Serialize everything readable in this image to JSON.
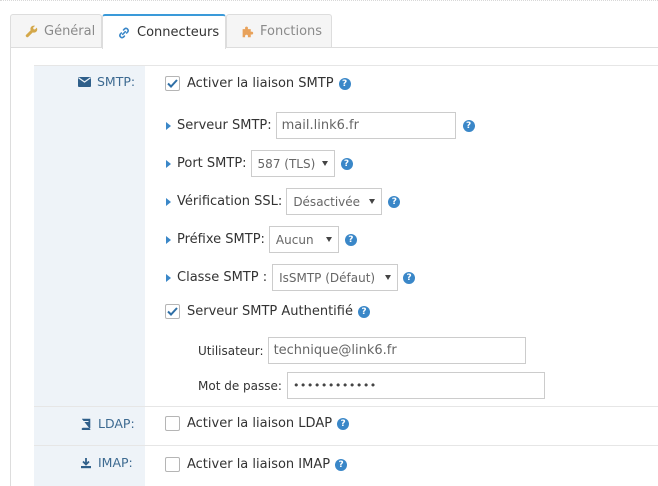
{
  "tabs": [
    {
      "label": "Général",
      "icon": "wrench-icon"
    },
    {
      "label": "Connecteurs",
      "icon": "link-icon"
    },
    {
      "label": "Fonctions",
      "icon": "puzzle-icon"
    }
  ],
  "colors": {
    "accent": "#3a87c8",
    "label_bg": "#eef3f8",
    "tab_active_border": "#3a9ad9"
  },
  "smtp": {
    "section_label": "SMTP:",
    "enable_label": "Activer la liaison SMTP",
    "enabled": true,
    "server_label": "Serveur SMTP:",
    "server_value": "mail.link6.fr",
    "port_label": "Port SMTP:",
    "port_value": "587 (TLS)",
    "ssl_label": "Vérification SSL:",
    "ssl_value": "Désactivée",
    "prefix_label": "Préfixe SMTP:",
    "prefix_value": "Aucun",
    "class_label": "Classe SMTP :",
    "class_value": "IsSMTP (Défaut)",
    "auth_label": "Serveur SMTP Authentifié",
    "auth_enabled": true,
    "user_label": "Utilisateur:",
    "user_value": "technique@link6.fr",
    "password_label": "Mot de passe:",
    "password_value": "••••••••••••"
  },
  "ldap": {
    "section_label": "LDAP:",
    "enable_label": "Activer la liaison LDAP",
    "enabled": false
  },
  "imap": {
    "section_label": "IMAP:",
    "enable_label": "Activer la liaison IMAP",
    "enabled": false
  }
}
